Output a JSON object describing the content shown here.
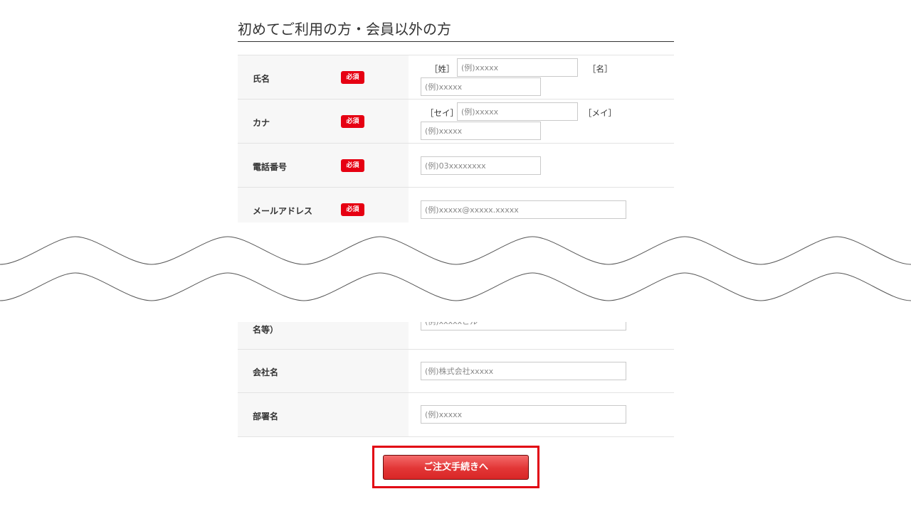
{
  "section_title": "初めてご利用の方・会員以外の方",
  "required_label": "必須",
  "form_top": [
    {
      "label": "氏名",
      "required": true,
      "bracket_first": "［姓］",
      "bracket_second": "［名］",
      "placeholder_first": "(例)xxxxx",
      "placeholder_second": "(例)xxxxx"
    },
    {
      "label": "カナ",
      "required": true,
      "bracket_first": "［セイ］",
      "bracket_second": "［メイ］",
      "placeholder_first": "(例)xxxxx",
      "placeholder_second": "(例)xxxxx"
    },
    {
      "label": "電話番号",
      "required": true,
      "placeholder": "(例)03xxxxxxxx"
    },
    {
      "label": "メールアドレス",
      "required": true,
      "placeholder": "(例)xxxxx@xxxxx.xxxxx"
    }
  ],
  "form_bottom": [
    {
      "label": "名等）",
      "required": false,
      "placeholder": "(例)xxxxxビル"
    },
    {
      "label": "会社名",
      "required": false,
      "placeholder": "(例)株式会社xxxxx"
    },
    {
      "label": "部署名",
      "required": false,
      "placeholder": "(例)xxxxx"
    }
  ],
  "submit_label": "ご注文手続きへ",
  "colors": {
    "required_badge": "#e60012",
    "button_gradient_top": "#f46a6a",
    "button_gradient_bottom": "#d92727",
    "highlight_frame": "#e10012",
    "label_background": "#f7f7f7"
  }
}
